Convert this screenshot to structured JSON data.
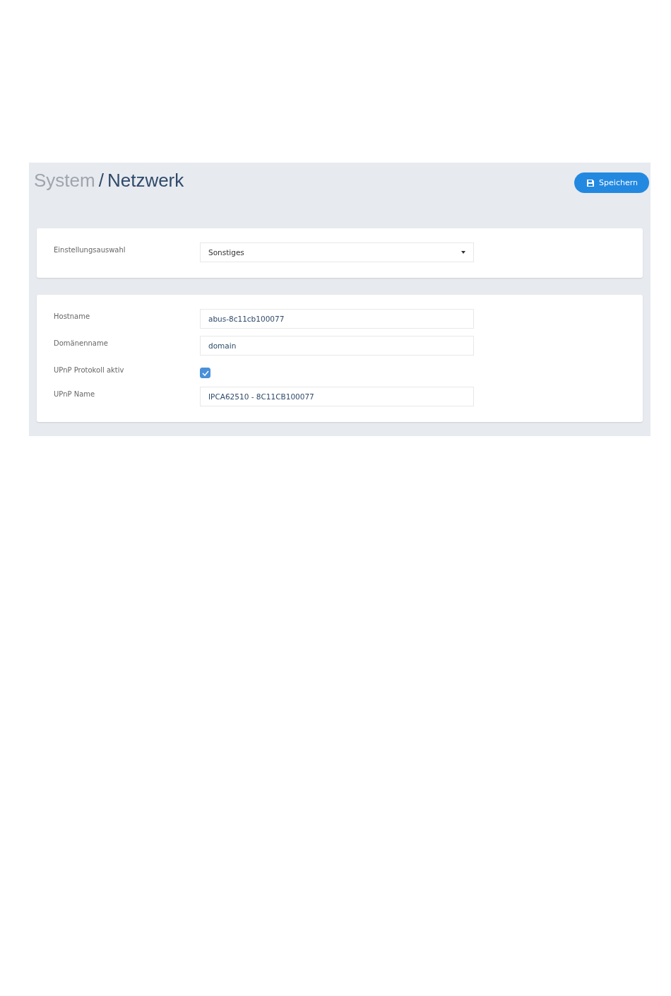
{
  "breadcrumb": {
    "parent": "System",
    "separator": "/",
    "current": "Netzwerk"
  },
  "save_button": {
    "label": "Speichern"
  },
  "cards": [
    {
      "rows": [
        {
          "kind": "select",
          "label": "Einstellungsauswahl",
          "value": "Sonstiges"
        }
      ]
    },
    {
      "rows": [
        {
          "kind": "text",
          "label": "Hostname",
          "value": "abus-8c11cb100077"
        },
        {
          "kind": "text",
          "label": "Domänenname",
          "value": "domain"
        },
        {
          "kind": "checkbox",
          "label": "UPnP Protokoll aktiv",
          "checked": true
        },
        {
          "kind": "text",
          "label": "UPnP Name",
          "value": "IPCA62510 - 8C11CB100077"
        }
      ]
    }
  ]
}
